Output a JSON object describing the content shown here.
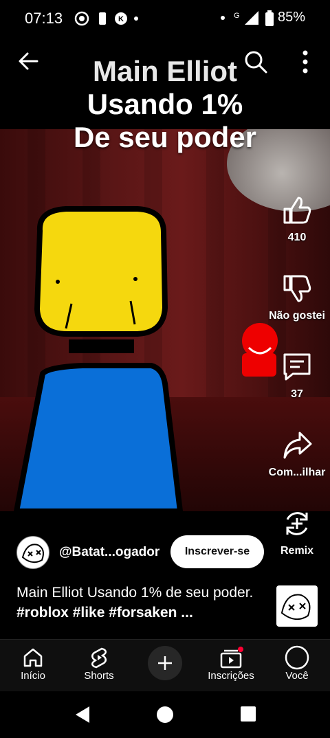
{
  "status_bar": {
    "time": "07:13",
    "battery": "85%"
  },
  "overlay_title": {
    "line1": "Main Elliot",
    "line2": "Usando 1%",
    "line3": "De seu poder"
  },
  "actions": {
    "like_count": "410",
    "dislike_label": "Não gostei",
    "comments_count": "37",
    "share_label": "Com...ilhar",
    "remix_label": "Remix"
  },
  "channel": {
    "handle": "@Batat...ogador",
    "subscribe_label": "Inscrever-se"
  },
  "description": {
    "text": "Main Elliot Usando 1% de seu poder.",
    "tags": "#roblox #like #forsaken ..."
  },
  "nav": [
    {
      "label": "Início",
      "icon": "home-icon"
    },
    {
      "label": "Shorts",
      "icon": "shorts-icon"
    },
    {
      "label": "",
      "icon": "create-plus-icon"
    },
    {
      "label": "Inscrições",
      "icon": "subscriptions-icon"
    },
    {
      "label": "Você",
      "icon": "you-icon"
    }
  ],
  "colors": {
    "accent_red": "#ff0033",
    "character_yellow": "#f5d80e",
    "character_blue": "#0a6fd8"
  }
}
